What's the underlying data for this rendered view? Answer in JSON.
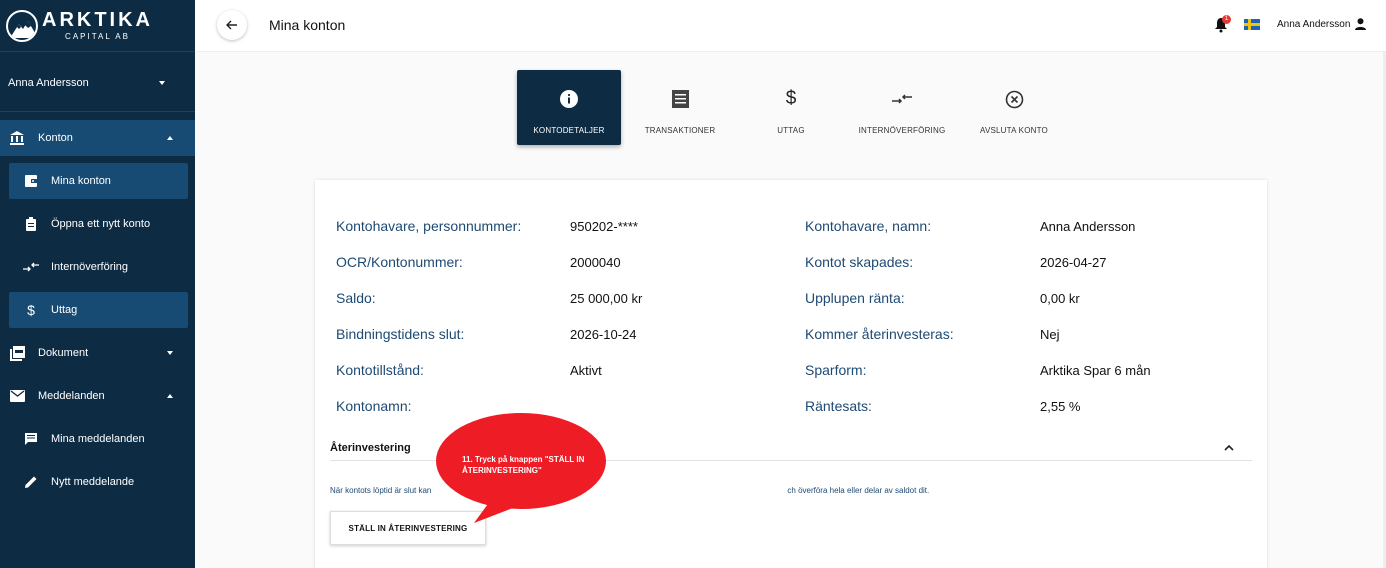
{
  "brand": {
    "name": "ARKTIKA",
    "sub": "CAPITAL AB"
  },
  "sidebar": {
    "user": "Anna Andersson",
    "sections": {
      "konton": "Konton",
      "dokument": "Dokument",
      "meddelanden": "Meddelanden"
    },
    "items": {
      "mina_konton": "Mina konton",
      "oppna_konto": "Öppna ett nytt konto",
      "internoverforing": "Internöverföring",
      "uttag": "Uttag",
      "mina_meddelanden": "Mina meddelanden",
      "nytt_meddelande": "Nytt meddelande"
    }
  },
  "topbar": {
    "title": "Mina konton",
    "notification_count": "1",
    "user": "Anna Andersson"
  },
  "tabs": {
    "kontodetaljer": "KONTODETALJER",
    "transaktioner": "TRANSAKTIONER",
    "uttag": "UTTAG",
    "internoverforing": "INTERNÖVERFÖRING",
    "avsluta": "AVSLUTA KONTO"
  },
  "details": {
    "personnummer_label": "Kontohavare, personnummer:",
    "personnummer_value": "950202-****",
    "ocr_label": "OCR/Kontonummer:",
    "ocr_value": "2000040",
    "saldo_label": "Saldo:",
    "saldo_value": "25 000,00 kr",
    "bindning_label": "Bindningstidens slut:",
    "bindning_value": "2026-10-24",
    "tillstand_label": "Kontotillstånd:",
    "tillstand_value": "Aktivt",
    "kontonamn_label": "Kontonamn:",
    "namn_label": "Kontohavare, namn:",
    "namn_value": "Anna Andersson",
    "skapades_label": "Kontot skapades:",
    "skapades_value": "2026-04-27",
    "ranta_label": "Upplupen ränta:",
    "ranta_value": "0,00 kr",
    "aterinvest_label": "Kommer återinvesteras:",
    "aterinvest_value": "Nej",
    "sparform_label": "Sparform:",
    "sparform_value": "Arktika Spar 6 mån",
    "rantesats_label": "Räntesats:",
    "rantesats_value": "2,55 %"
  },
  "reinvest": {
    "title": "Återinvestering",
    "text_start": "När kontots löptid är slut kan",
    "text_end": "ch överföra hela eller delar av saldot dit.",
    "button": "STÄLL IN ÅTERINVESTERING"
  },
  "callout": {
    "text": "11. Tryck på knappen \"STÄLL IN ÅTERINVESTERING\""
  },
  "colors": {
    "sidebar": "#0d2c44",
    "sidebar_active": "#174b73",
    "label_blue": "#1e4a73",
    "callout_red": "#ee1c25"
  }
}
